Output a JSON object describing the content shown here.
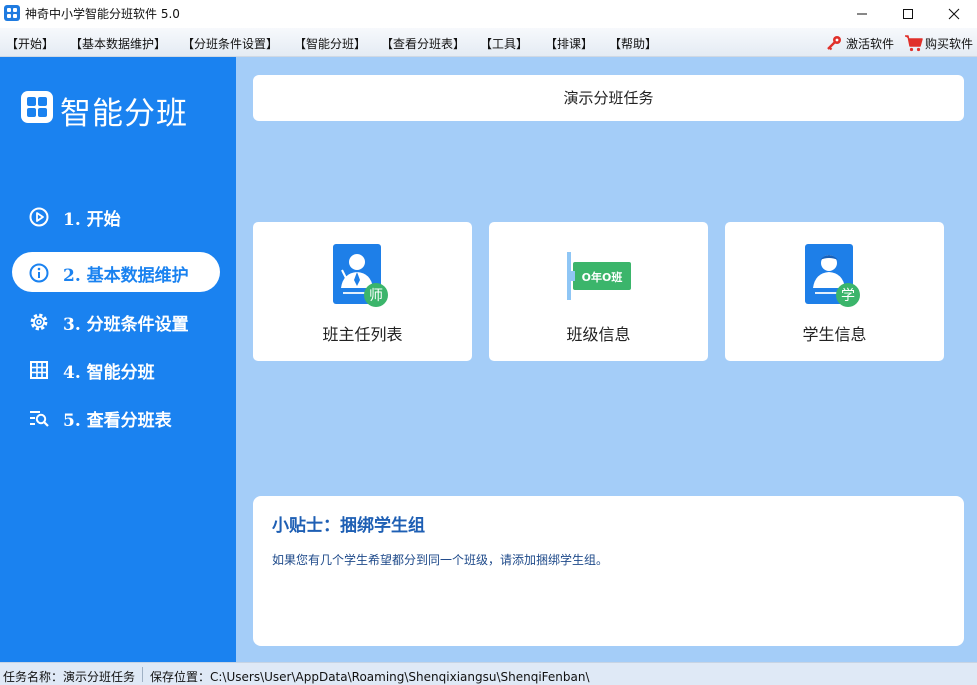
{
  "window": {
    "title": "神奇中小学智能分班软件 5.0"
  },
  "menu": {
    "items": [
      "【开始】",
      "【基本数据维护】",
      "【分班条件设置】",
      "【智能分班】",
      "【查看分班表】",
      "【工具】",
      "【排课】",
      "【帮助】"
    ],
    "activate_label": "激活软件",
    "buy_label": "购买软件"
  },
  "sidebar": {
    "brand": "智能分班",
    "items": [
      {
        "label": "1. 开始",
        "icon": "play-circle-icon"
      },
      {
        "label": "2. 基本数据维护",
        "icon": "info-circle-icon",
        "active": true
      },
      {
        "label": "3. 分班条件设置",
        "icon": "gear-icon"
      },
      {
        "label": "4. 智能分班",
        "icon": "table-icon"
      },
      {
        "label": "5. 查看分班表",
        "icon": "search-list-icon"
      }
    ]
  },
  "main": {
    "task_name": "演示分班任务",
    "cards": [
      {
        "label": "班主任列表",
        "icon": "teacher-icon",
        "badge": "师"
      },
      {
        "label": "班级信息",
        "icon": "class-sign-icon",
        "sign": "O年O班"
      },
      {
        "label": "学生信息",
        "icon": "student-icon",
        "badge": "学"
      }
    ],
    "tips": {
      "title": "小贴士：捆绑学生组",
      "body": "如果您有几个学生希望都分到同一个班级，请添加捆绑学生组。"
    }
  },
  "status": {
    "task": "任务名称：演示分班任务",
    "path": "保存位置：C:\\Users\\User\\AppData\\Roaming\\Shenqixiangsu\\ShenqiFenban\\"
  },
  "colors": {
    "sidebar": "#1a82f0",
    "main_bg": "#a4cdf8",
    "accent": "#1a82f0",
    "badge_green": "#3bb56b",
    "tips_title": "#1e5fb4"
  }
}
